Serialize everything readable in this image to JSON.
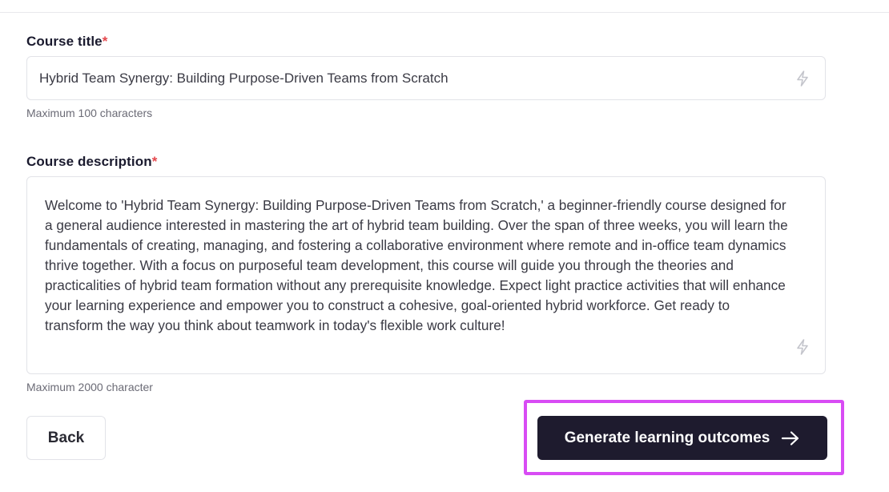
{
  "course_title": {
    "label": "Course title",
    "required_mark": "*",
    "value": "Hybrid Team Synergy: Building Purpose-Driven Teams from Scratch",
    "hint": "Maximum 100 characters",
    "action_icon": "bolt-icon"
  },
  "course_description": {
    "label": "Course description",
    "required_mark": "*",
    "value": "Welcome to 'Hybrid Team Synergy: Building Purpose-Driven Teams from Scratch,' a beginner-friendly course designed for a general audience interested in mastering the art of hybrid team building. Over the span of three weeks, you will learn the fundamentals of creating, managing, and fostering a collaborative environment where remote and in-office team dynamics thrive together. With a focus on purposeful team development, this course will guide you through the theories and practicalities of hybrid team formation without any prerequisite knowledge. Expect light practice activities that will enhance your learning experience and empower you to construct a cohesive, goal-oriented hybrid workforce. Get ready to transform the way you think about teamwork in today's flexible work culture!",
    "hint": "Maximum 2000 character",
    "action_icon": "bolt-icon"
  },
  "actions": {
    "back_label": "Back",
    "generate_label": "Generate learning outcomes",
    "generate_icon": "arrow-right-icon"
  },
  "colors": {
    "required": "#e5484d",
    "primary_button": "#1e1b2e",
    "highlight": "#d84cf4"
  }
}
